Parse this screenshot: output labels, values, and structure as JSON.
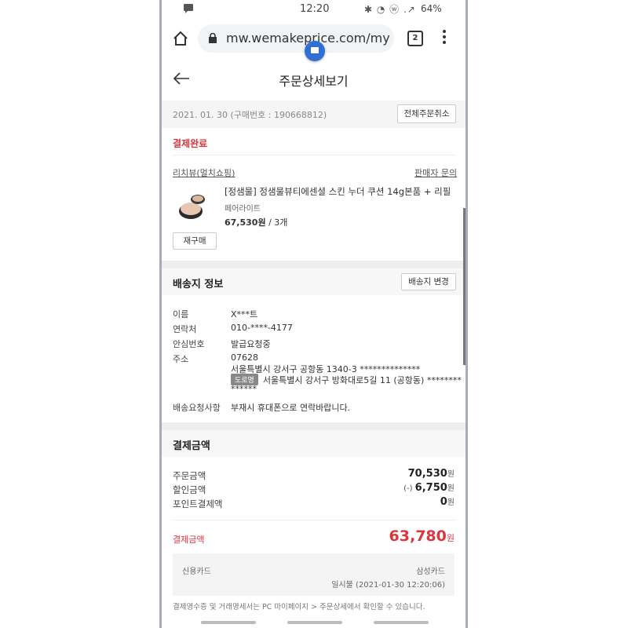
{
  "status_bar": {
    "time": "12:20",
    "icons": "✱ ◔ ⓦ .↗",
    "battery": "64%"
  },
  "browser": {
    "url": "mw.wemakeprice.com/mypag",
    "tab_count": "2"
  },
  "header": {
    "title": "주문상세보기"
  },
  "order": {
    "date_info": "2021. 01. 30 (구매번호 : 190668812)",
    "cancel_all_label": "전체주문취소",
    "status": "결제완료",
    "seller": "리치뷰(멀치쇼핑)",
    "seller_inquiry": "판매자 문의",
    "product_name": "[정샘물] 정샘물뷰티에센셜 스킨 누더 쿠션 14g본품 + 리필",
    "product_option": "페어라이트",
    "price": "67,530원",
    "quantity": " / 3개",
    "rebuy_label": "재구매"
  },
  "shipping": {
    "title": "배송지 정보",
    "change_label": "배송지 변경",
    "rows": [
      {
        "label": "이름",
        "value": "X***트"
      },
      {
        "label": "연락처",
        "value": "010-****-4177"
      },
      {
        "label": "안심번호",
        "value": "발급요청중"
      },
      {
        "label": "주소",
        "value": "07628"
      }
    ],
    "address_lot": "서울특별시 강서구 공항동 1340-3 **************",
    "road_tag": "도로명",
    "address_road": "서울특별시 강서구 방화대로5길 11 (공항동) ********",
    "address_road_cont": "******",
    "request_label": "배송요청사항",
    "request_value": "부재시 휴대폰으로 연락바랍니다."
  },
  "payment": {
    "title": "결제금액",
    "order_amount_label": "주문금액",
    "order_amount": "70,530",
    "discount_label": "할인금액",
    "discount_prefix": "(-) ",
    "discount": "6,750",
    "points_label": "포인트결제액",
    "points": "0",
    "won": "원",
    "total_label": "결제금액",
    "total": "63,780",
    "method": "신용카드",
    "card_name": "삼성카드",
    "installment": "일시불 (2021-01-30 12:20:06)",
    "footer_note": "결제영수증 및 거래명세서는 PC 마이페이지 > 주문상세에서 확인할 수 있습니다."
  },
  "colors": {
    "accent_red": "#d9363e",
    "chat_blue": "#2f6fd6"
  }
}
